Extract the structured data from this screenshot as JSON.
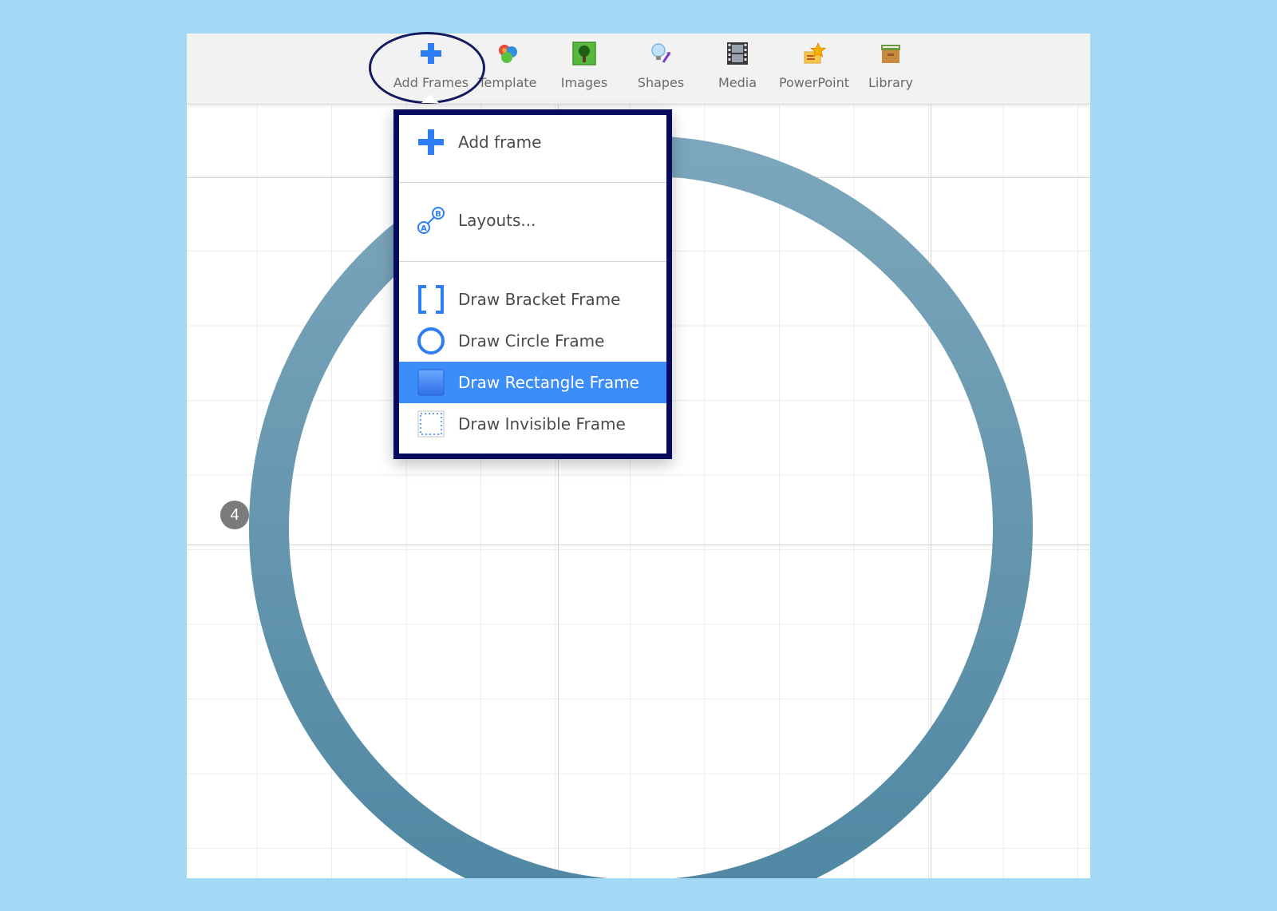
{
  "toolbar": {
    "tools": [
      {
        "label": "Add Frames",
        "icon": "plus-icon"
      },
      {
        "label": "Template",
        "icon": "color-circles-icon"
      },
      {
        "label": "Images",
        "icon": "tree-image-icon"
      },
      {
        "label": "Shapes",
        "icon": "lightbulb-shapes-icon"
      },
      {
        "label": "Media",
        "icon": "film-strip-icon"
      },
      {
        "label": "PowerPoint",
        "icon": "powerpoint-star-icon"
      },
      {
        "label": "Library",
        "icon": "archive-box-icon"
      }
    ]
  },
  "dropdown": {
    "items": [
      {
        "label": "Add frame",
        "icon": "plus-icon"
      },
      {
        "label": "Layouts...",
        "icon": "layouts-ab-icon"
      },
      {
        "label": "Draw Bracket Frame",
        "icon": "bracket-frame-icon"
      },
      {
        "label": "Draw Circle Frame",
        "icon": "circle-frame-icon"
      },
      {
        "label": "Draw Rectangle Frame",
        "icon": "rectangle-frame-icon",
        "selected": true
      },
      {
        "label": "Draw Invisible Frame",
        "icon": "invisible-frame-icon"
      }
    ]
  },
  "canvas": {
    "frame_number": "4",
    "ring_color_top": "#7ca6bb",
    "ring_color_bottom": "#4f87a2"
  },
  "colors": {
    "background": "#a3d9f5",
    "highlight_outline": "#141a5e",
    "dropdown_border": "#080a5c",
    "selected_item": "#3c8dfa",
    "accent_blue": "#2f7df6"
  }
}
